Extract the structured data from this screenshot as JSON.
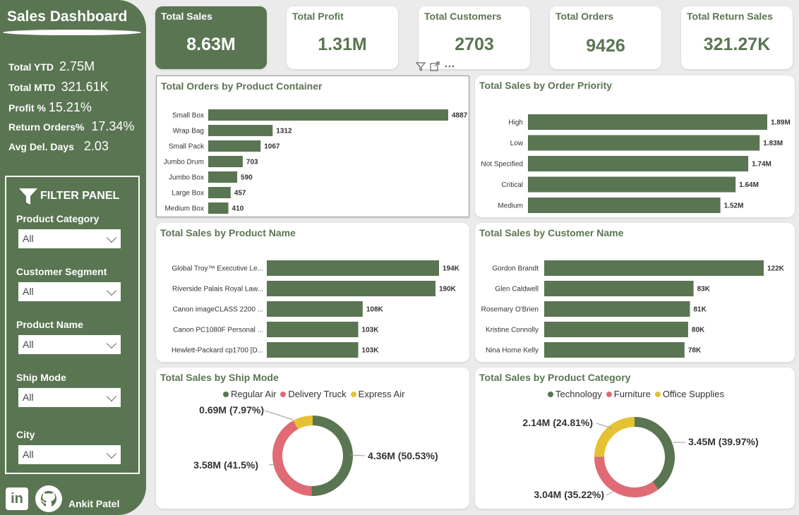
{
  "sidebar": {
    "title": "Sales Dashboard",
    "kpis": [
      {
        "label": "Total YTD",
        "value": "2.75M"
      },
      {
        "label": "Total MTD",
        "value": "321.61K"
      },
      {
        "label": "Profit %",
        "value": "15.21%"
      },
      {
        "label": "Return Orders%",
        "value": "17.34%"
      },
      {
        "label": "Avg Del. Days",
        "value": "2.03"
      }
    ],
    "filter_panel": {
      "title": "FILTER PANEL",
      "filters": [
        {
          "label": "Product Category",
          "value": "All"
        },
        {
          "label": "Customer Segment",
          "value": "All"
        },
        {
          "label": "Product Name",
          "value": "All"
        },
        {
          "label": "Ship Mode",
          "value": "All"
        },
        {
          "label": "City",
          "value": "All"
        }
      ]
    },
    "footer": {
      "linkedin_glyph": "in",
      "author": "Ankit Patel"
    }
  },
  "kpi_cards": [
    {
      "title": "Total Sales",
      "value": "8.63M"
    },
    {
      "title": "Total Profit",
      "value": "1.31M"
    },
    {
      "title": "Total Customers",
      "value": "2703"
    },
    {
      "title": "Total Orders",
      "value": "9426"
    },
    {
      "title": "Total Return Sales",
      "value": "321.27K"
    }
  ],
  "colors": {
    "accent": "#5a7552",
    "bar": "#5a7552",
    "technology": "#5a7552",
    "furniture": "#e06b74",
    "office_supplies": "#e5c232",
    "regular_air": "#5a7552",
    "delivery_truck": "#e06b74",
    "express_air": "#e5c232"
  },
  "chart_data": [
    {
      "type": "bar",
      "orientation": "horizontal",
      "title": "Total Orders by Product Container",
      "categories": [
        "Small Box",
        "Wrap Bag",
        "Small Pack",
        "Jumbo Drum",
        "Jumbo Box",
        "Large Box",
        "Medium Box"
      ],
      "values": [
        4887,
        1312,
        1067,
        703,
        590,
        457,
        410
      ],
      "value_labels": [
        "4887",
        "1312",
        "1067",
        "703",
        "590",
        "457",
        "410"
      ],
      "xlim": [
        0,
        4887
      ]
    },
    {
      "type": "bar",
      "orientation": "horizontal",
      "title": "Total Sales by Order Priority",
      "categories": [
        "High",
        "Low",
        "Not Specified",
        "Critical",
        "Medium"
      ],
      "values": [
        1.89,
        1.83,
        1.74,
        1.64,
        1.52
      ],
      "value_labels": [
        "1.89M",
        "1.83M",
        "1.74M",
        "1.64M",
        "1.52M"
      ],
      "xlim": [
        0,
        1.89
      ]
    },
    {
      "type": "bar",
      "orientation": "horizontal",
      "title": "Total Sales by Product Name",
      "categories": [
        "Global Troy™ Executive Le...",
        "Riverside Palais Royal Law...",
        "Canon imageCLASS 2200 ...",
        "Canon PC1080F Personal ...",
        "Hewlett-Packard cp1700 [D..."
      ],
      "values": [
        194,
        190,
        108,
        103,
        103
      ],
      "value_labels": [
        "194K",
        "190K",
        "108K",
        "103K",
        "103K"
      ],
      "xlim": [
        0,
        194
      ]
    },
    {
      "type": "bar",
      "orientation": "horizontal",
      "title": "Total Sales by Customer Name",
      "categories": [
        "Gordon Brandt",
        "Glen Caldwell",
        "Rosemary O'Brien",
        "Kristine Connolly",
        "Nina Horne Kelly"
      ],
      "values": [
        122,
        83,
        81,
        80,
        78
      ],
      "value_labels": [
        "122K",
        "83K",
        "81K",
        "80K",
        "78K"
      ],
      "xlim": [
        0,
        122
      ]
    },
    {
      "type": "pie",
      "donut": true,
      "title": "Total Sales by Ship Mode",
      "legend_position": "top",
      "series": [
        {
          "name": "Regular Air",
          "value": 4.36,
          "label": "4.36M (50.53%)",
          "percent": 50.53
        },
        {
          "name": "Delivery Truck",
          "value": 3.58,
          "label": "3.58M (41.5%)",
          "percent": 41.5
        },
        {
          "name": "Express Air",
          "value": 0.69,
          "label": "0.69M (7.97%)",
          "percent": 7.97
        }
      ]
    },
    {
      "type": "pie",
      "donut": true,
      "title": "Total Sales by Product Category",
      "legend_position": "top",
      "series": [
        {
          "name": "Technology",
          "value": 3.45,
          "label": "3.45M (39.97%)",
          "percent": 39.97
        },
        {
          "name": "Furniture",
          "value": 3.04,
          "label": "3.04M (35.22%)",
          "percent": 35.22
        },
        {
          "name": "Office Supplies",
          "value": 2.14,
          "label": "2.14M (24.81%)",
          "percent": 24.81
        }
      ]
    }
  ]
}
